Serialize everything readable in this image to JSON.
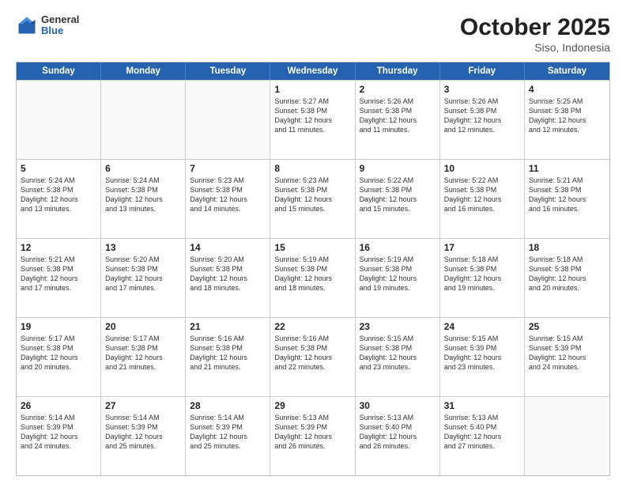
{
  "header": {
    "logo": {
      "general": "General",
      "blue": "Blue"
    },
    "title": "October 2025",
    "location": "Siso, Indonesia"
  },
  "weekdays": [
    "Sunday",
    "Monday",
    "Tuesday",
    "Wednesday",
    "Thursday",
    "Friday",
    "Saturday"
  ],
  "rows": [
    [
      {
        "day": "",
        "empty": true,
        "lines": []
      },
      {
        "day": "",
        "empty": true,
        "lines": []
      },
      {
        "day": "",
        "empty": true,
        "lines": []
      },
      {
        "day": "1",
        "empty": false,
        "lines": [
          "Sunrise: 5:27 AM",
          "Sunset: 5:38 PM",
          "Daylight: 12 hours",
          "and 11 minutes."
        ]
      },
      {
        "day": "2",
        "empty": false,
        "lines": [
          "Sunrise: 5:26 AM",
          "Sunset: 5:38 PM",
          "Daylight: 12 hours",
          "and 11 minutes."
        ]
      },
      {
        "day": "3",
        "empty": false,
        "lines": [
          "Sunrise: 5:26 AM",
          "Sunset: 5:38 PM",
          "Daylight: 12 hours",
          "and 12 minutes."
        ]
      },
      {
        "day": "4",
        "empty": false,
        "lines": [
          "Sunrise: 5:25 AM",
          "Sunset: 5:38 PM",
          "Daylight: 12 hours",
          "and 12 minutes."
        ]
      }
    ],
    [
      {
        "day": "5",
        "empty": false,
        "lines": [
          "Sunrise: 5:24 AM",
          "Sunset: 5:38 PM",
          "Daylight: 12 hours",
          "and 13 minutes."
        ]
      },
      {
        "day": "6",
        "empty": false,
        "lines": [
          "Sunrise: 5:24 AM",
          "Sunset: 5:38 PM",
          "Daylight: 12 hours",
          "and 13 minutes."
        ]
      },
      {
        "day": "7",
        "empty": false,
        "lines": [
          "Sunrise: 5:23 AM",
          "Sunset: 5:38 PM",
          "Daylight: 12 hours",
          "and 14 minutes."
        ]
      },
      {
        "day": "8",
        "empty": false,
        "lines": [
          "Sunrise: 5:23 AM",
          "Sunset: 5:38 PM",
          "Daylight: 12 hours",
          "and 15 minutes."
        ]
      },
      {
        "day": "9",
        "empty": false,
        "lines": [
          "Sunrise: 5:22 AM",
          "Sunset: 5:38 PM",
          "Daylight: 12 hours",
          "and 15 minutes."
        ]
      },
      {
        "day": "10",
        "empty": false,
        "lines": [
          "Sunrise: 5:22 AM",
          "Sunset: 5:38 PM",
          "Daylight: 12 hours",
          "and 16 minutes."
        ]
      },
      {
        "day": "11",
        "empty": false,
        "lines": [
          "Sunrise: 5:21 AM",
          "Sunset: 5:38 PM",
          "Daylight: 12 hours",
          "and 16 minutes."
        ]
      }
    ],
    [
      {
        "day": "12",
        "empty": false,
        "lines": [
          "Sunrise: 5:21 AM",
          "Sunset: 5:38 PM",
          "Daylight: 12 hours",
          "and 17 minutes."
        ]
      },
      {
        "day": "13",
        "empty": false,
        "lines": [
          "Sunrise: 5:20 AM",
          "Sunset: 5:38 PM",
          "Daylight: 12 hours",
          "and 17 minutes."
        ]
      },
      {
        "day": "14",
        "empty": false,
        "lines": [
          "Sunrise: 5:20 AM",
          "Sunset: 5:38 PM",
          "Daylight: 12 hours",
          "and 18 minutes."
        ]
      },
      {
        "day": "15",
        "empty": false,
        "lines": [
          "Sunrise: 5:19 AM",
          "Sunset: 5:38 PM",
          "Daylight: 12 hours",
          "and 18 minutes."
        ]
      },
      {
        "day": "16",
        "empty": false,
        "lines": [
          "Sunrise: 5:19 AM",
          "Sunset: 5:38 PM",
          "Daylight: 12 hours",
          "and 19 minutes."
        ]
      },
      {
        "day": "17",
        "empty": false,
        "lines": [
          "Sunrise: 5:18 AM",
          "Sunset: 5:38 PM",
          "Daylight: 12 hours",
          "and 19 minutes."
        ]
      },
      {
        "day": "18",
        "empty": false,
        "lines": [
          "Sunrise: 5:18 AM",
          "Sunset: 5:38 PM",
          "Daylight: 12 hours",
          "and 20 minutes."
        ]
      }
    ],
    [
      {
        "day": "19",
        "empty": false,
        "lines": [
          "Sunrise: 5:17 AM",
          "Sunset: 5:38 PM",
          "Daylight: 12 hours",
          "and 20 minutes."
        ]
      },
      {
        "day": "20",
        "empty": false,
        "lines": [
          "Sunrise: 5:17 AM",
          "Sunset: 5:38 PM",
          "Daylight: 12 hours",
          "and 21 minutes."
        ]
      },
      {
        "day": "21",
        "empty": false,
        "lines": [
          "Sunrise: 5:16 AM",
          "Sunset: 5:38 PM",
          "Daylight: 12 hours",
          "and 21 minutes."
        ]
      },
      {
        "day": "22",
        "empty": false,
        "lines": [
          "Sunrise: 5:16 AM",
          "Sunset: 5:38 PM",
          "Daylight: 12 hours",
          "and 22 minutes."
        ]
      },
      {
        "day": "23",
        "empty": false,
        "lines": [
          "Sunrise: 5:15 AM",
          "Sunset: 5:38 PM",
          "Daylight: 12 hours",
          "and 23 minutes."
        ]
      },
      {
        "day": "24",
        "empty": false,
        "lines": [
          "Sunrise: 5:15 AM",
          "Sunset: 5:39 PM",
          "Daylight: 12 hours",
          "and 23 minutes."
        ]
      },
      {
        "day": "25",
        "empty": false,
        "lines": [
          "Sunrise: 5:15 AM",
          "Sunset: 5:39 PM",
          "Daylight: 12 hours",
          "and 24 minutes."
        ]
      }
    ],
    [
      {
        "day": "26",
        "empty": false,
        "lines": [
          "Sunrise: 5:14 AM",
          "Sunset: 5:39 PM",
          "Daylight: 12 hours",
          "and 24 minutes."
        ]
      },
      {
        "day": "27",
        "empty": false,
        "lines": [
          "Sunrise: 5:14 AM",
          "Sunset: 5:39 PM",
          "Daylight: 12 hours",
          "and 25 minutes."
        ]
      },
      {
        "day": "28",
        "empty": false,
        "lines": [
          "Sunrise: 5:14 AM",
          "Sunset: 5:39 PM",
          "Daylight: 12 hours",
          "and 25 minutes."
        ]
      },
      {
        "day": "29",
        "empty": false,
        "lines": [
          "Sunrise: 5:13 AM",
          "Sunset: 5:39 PM",
          "Daylight: 12 hours",
          "and 26 minutes."
        ]
      },
      {
        "day": "30",
        "empty": false,
        "lines": [
          "Sunrise: 5:13 AM",
          "Sunset: 5:40 PM",
          "Daylight: 12 hours",
          "and 26 minutes."
        ]
      },
      {
        "day": "31",
        "empty": false,
        "lines": [
          "Sunrise: 5:13 AM",
          "Sunset: 5:40 PM",
          "Daylight: 12 hours",
          "and 27 minutes."
        ]
      },
      {
        "day": "",
        "empty": true,
        "lines": []
      }
    ]
  ]
}
